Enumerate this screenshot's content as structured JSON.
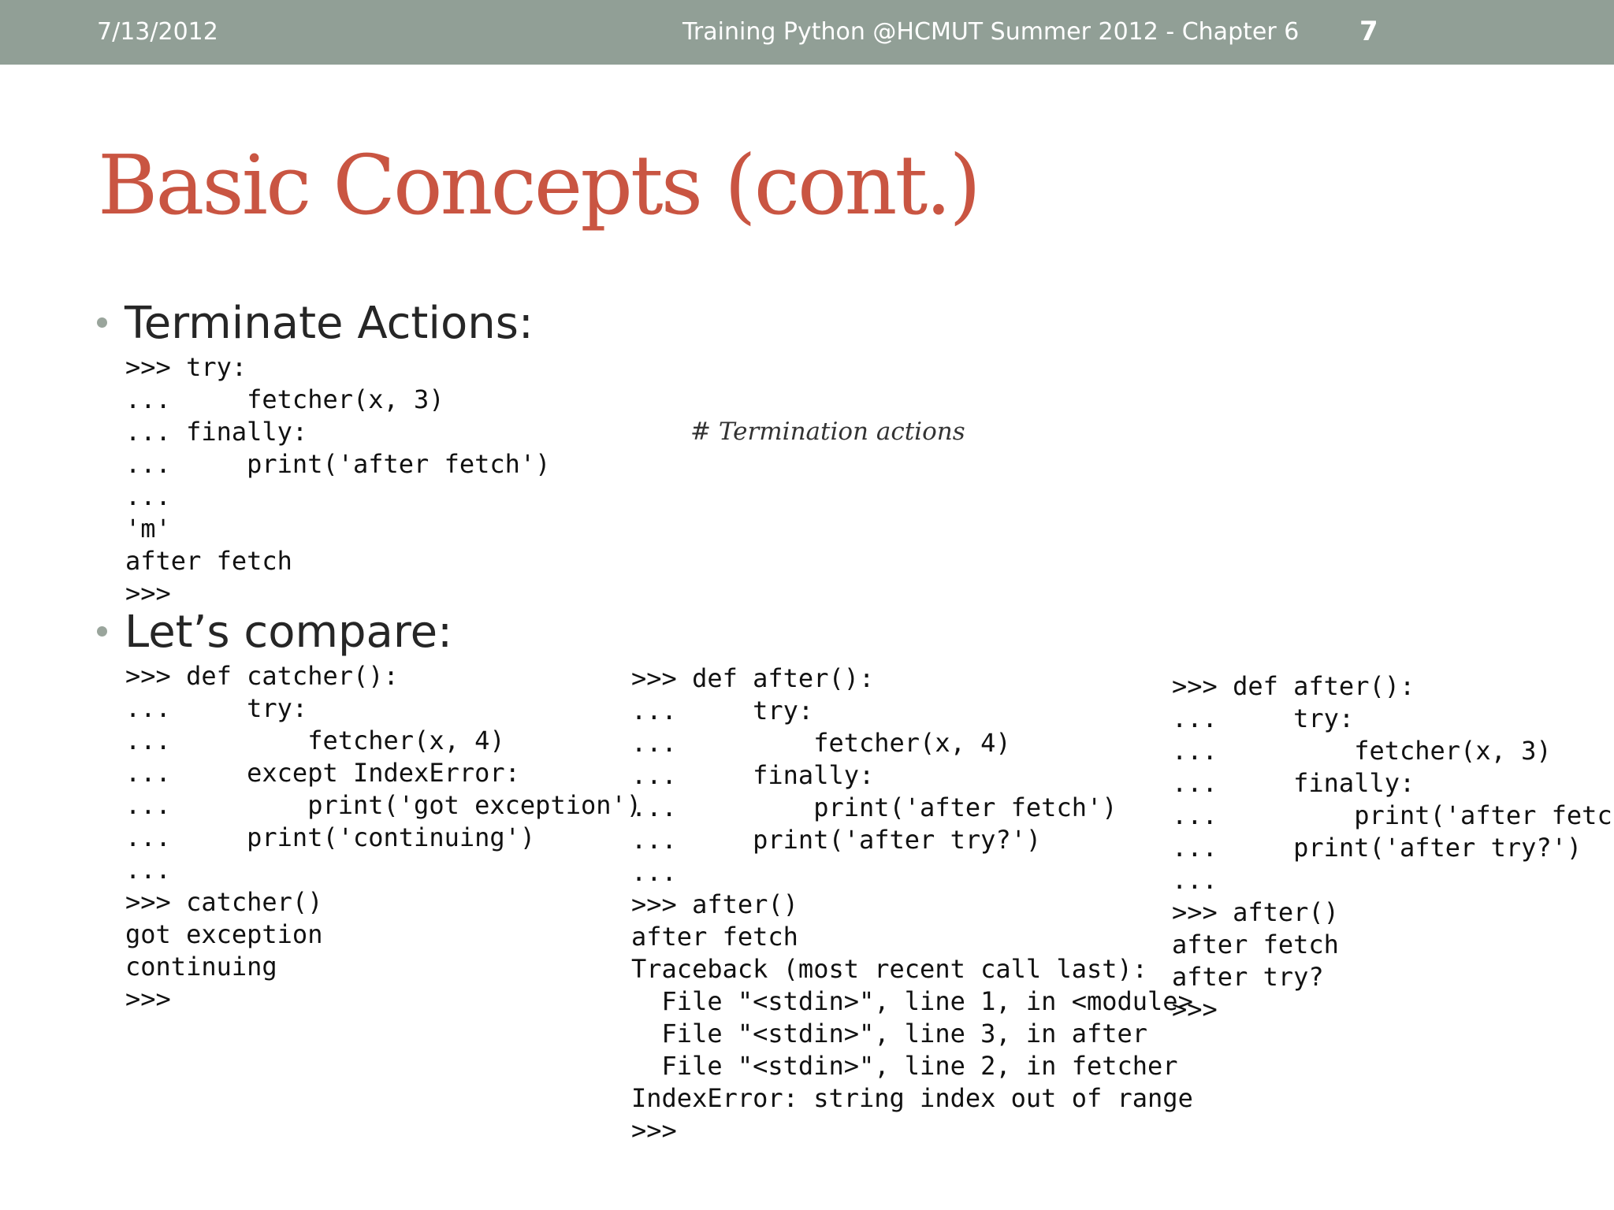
{
  "header": {
    "date": "7/13/2012",
    "course": "Training Python @HCMUT Summer 2012 - Chapter 6",
    "page": "7"
  },
  "title": "Basic Concepts (cont.)",
  "bullets": [
    {
      "label": "Terminate Actions:"
    },
    {
      "label": "Let’s compare:"
    }
  ],
  "comment": "# Termination actions",
  "code_blocks": {
    "terminate": [
      ">>> try:",
      "...     fetcher(x, 3)",
      "... finally:",
      "...     print('after fetch')",
      "...",
      "'m'",
      "after fetch",
      ">>>"
    ],
    "catcher": [
      ">>> def catcher():",
      "...     try:",
      "...         fetcher(x, 4)",
      "...     except IndexError:",
      "...         print('got exception')",
      "...     print('continuing')",
      "...",
      ">>> catcher()",
      "got exception",
      "continuing",
      ">>>"
    ],
    "after_error": [
      ">>> def after():",
      "...     try:",
      "...         fetcher(x, 4)",
      "...     finally:",
      "...         print('after fetch')",
      "...     print('after try?')",
      "...",
      ">>> after()",
      "after fetch",
      "Traceback (most recent call last):",
      "  File \"<stdin>\", line 1, in <module>",
      "  File \"<stdin>\", line 3, in after",
      "  File \"<stdin>\", line 2, in fetcher",
      "IndexError: string index out of range",
      ">>>"
    ],
    "after_ok": [
      ">>> def after():",
      "...     try:",
      "...         fetcher(x, 3)",
      "...     finally:",
      "...         print('after fetch')",
      "...     print('after try?')",
      "...",
      ">>> after()",
      "after fetch",
      "after try?",
      ">>>"
    ]
  },
  "colors": {
    "header_bar": "#919f96",
    "title": "#c95542",
    "bullet_dot": "#9aa59c"
  }
}
